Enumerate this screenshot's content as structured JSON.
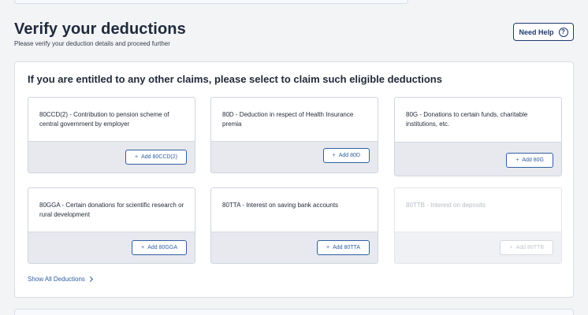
{
  "header": {
    "title": "Verify your deductions",
    "subtitle": "Please verify your deduction details and proceed further",
    "help_label": "Need Help",
    "help_icon": "?"
  },
  "panel": {
    "heading": "If you are entitled to any other claims, please select to claim such eligible deductions",
    "show_all_label": "Show All Deductions"
  },
  "deductions": [
    {
      "text": "80CCD(2) - Contribution to pension scheme of central government by employer",
      "button": "Add 80CCD(2)",
      "enabled": true
    },
    {
      "text": "80D - Deduction in respect of Health Insurance premia",
      "button": "Add 80D",
      "enabled": true
    },
    {
      "text": "80G - Donations to certain funds, charitable institutions, etc.",
      "button": "Add 80G",
      "enabled": true
    },
    {
      "text": "80GGA - Certain donations for scientific research or rural development",
      "button": "Add 80GGA",
      "enabled": true
    },
    {
      "text": "80TTA - Interest on saving bank accounts",
      "button": "Add 80TTA",
      "enabled": true
    },
    {
      "text": "80TTB - Interest on deposits",
      "button": "Add 80TTB",
      "enabled": false
    }
  ],
  "colors": {
    "accent": "#2f5fa3",
    "title": "#1e293b",
    "footer_bg": "#e7e9ee"
  },
  "icons": {
    "help": "question-circle-icon",
    "add": "plus-icon",
    "show_all": "chevron-right-icon"
  }
}
